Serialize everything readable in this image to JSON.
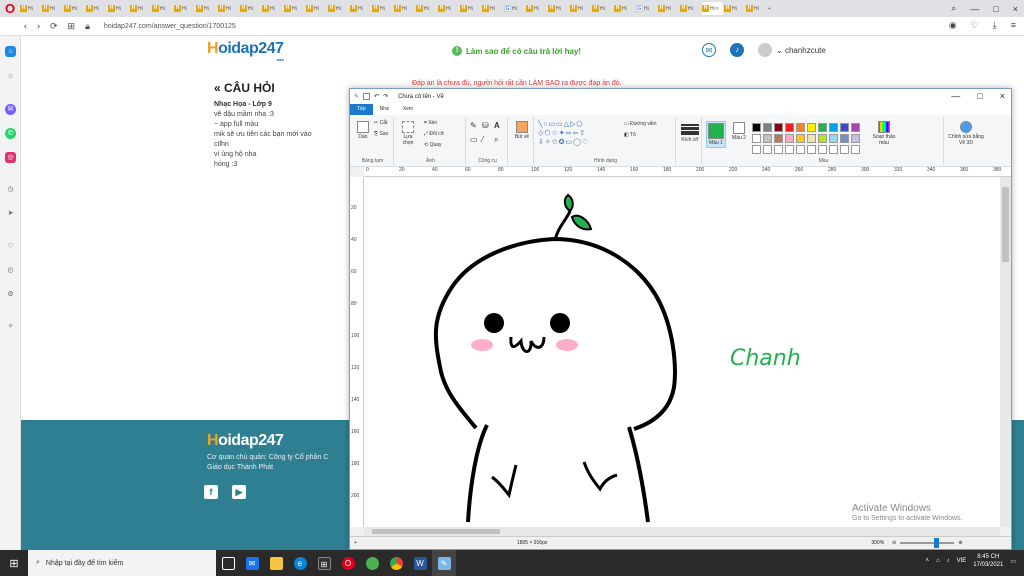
{
  "browser": {
    "url": "hoidap247.com/answer_question/1700125",
    "tab_h": "H",
    "tab_g": "G",
    "tab_text": "Hi",
    "active_tab": "Hi",
    "close": "×",
    "new_tab": "+",
    "minimize": "—",
    "maximize": "□",
    "back": "‹",
    "forward": "›",
    "reload": "⟳"
  },
  "site": {
    "logo_h": "H",
    "logo_rest": "oidap247",
    "logo_com": ".com",
    "hint": "Làm sao để có câu trả lời hay!",
    "username": "chanhzcute"
  },
  "question": {
    "heading": "« CÂU HỎI",
    "subject": "Nhạc Họa - Lớp 9",
    "lines": [
      "vẽ dậu mầm nha :3",
      "~ app full màu",
      "mik sẽ ưu tiên các bạn mới vào",
      "ctlhn",
      "vì ủng hộ nha",
      "hóng :3"
    ]
  },
  "answer_note": "Đáp án là chưa đủ, người hỏi rất cần LÀM SAO ra được đáp án đó.",
  "footer": {
    "line1": "Cơ quan chủ quản: Công ty Cổ phần C",
    "line2": "Giáo dục Thành Phát",
    "fb": "f",
    "yt": "▶"
  },
  "paint": {
    "title": "Chưa có tên - Vẽ",
    "tabs": [
      "Tệp",
      "Nhà",
      "Xem"
    ],
    "groups": {
      "clipboard": "Bảng tạm",
      "image": "Ảnh",
      "tools": "Công cụ",
      "shapes": "Hình dạng",
      "colors": "Màu"
    },
    "buttons": {
      "paste": "Dán",
      "cut": "Cắt",
      "copy": "Sao",
      "crop": "Xén",
      "resize": "Đổi cỡ",
      "rotate": "Quay",
      "select": "Lựa chọn",
      "brush": "Bút vẽ",
      "outline": "Đường viền",
      "fill": "Tô",
      "size": "Kích cỡ",
      "color1": "Màu 1",
      "color2": "Màu 2",
      "edit_colors": "Soạn thảo màu",
      "paint3d": "Chỉnh sửa bằng Vẽ 3D"
    },
    "color1": "#22b14c",
    "palette": [
      "#000000",
      "#7f7f7f",
      "#880015",
      "#ed1c24",
      "#ff7f27",
      "#fff200",
      "#22b14c",
      "#00a2e8",
      "#3f48cc",
      "#a349a4",
      "#ffffff",
      "#c3c3c3",
      "#b97a57",
      "#ffaec9",
      "#ffc90e",
      "#efe4b0",
      "#b5e61d",
      "#99d9ea",
      "#7092be",
      "#c8bfe7"
    ],
    "ruler_h": [
      "0",
      "20",
      "40",
      "60",
      "80",
      "100",
      "120",
      "140",
      "160",
      "180",
      "200",
      "220",
      "240",
      "260",
      "280",
      "300",
      "320",
      "340",
      "360",
      "380"
    ],
    "ruler_v": [
      "20",
      "40",
      "60",
      "80",
      "100",
      "120",
      "140",
      "160",
      "180",
      "200"
    ],
    "drawing_text": "Chanh",
    "dimensions": "1805 × 916px",
    "zoom": "300%"
  },
  "watermark": {
    "title": "Activate Windows",
    "subtitle": "Go to Settings to activate Windows."
  },
  "taskbar": {
    "search": "Nhập tại đây để tìm kiếm",
    "lang": "VIE",
    "time": "8:45 CH",
    "date": "17/03/2021"
  }
}
